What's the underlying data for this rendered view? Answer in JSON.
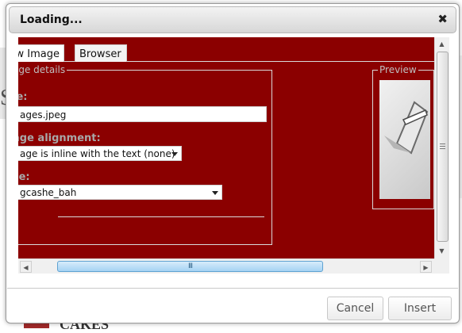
{
  "dialog": {
    "title": "Loading...",
    "close_glyph": "✖"
  },
  "tabs": [
    {
      "label": "w Image"
    },
    {
      "label": "Browser"
    }
  ],
  "details": {
    "legend": "age details",
    "file_label": "le:",
    "file_value": "ages.jpeg",
    "alignment_label": "age alignment:",
    "alignment_value": "age is inline with the text (none)",
    "size_label": "ze:",
    "size_value": "gcashe_bah"
  },
  "preview": {
    "legend": "Preview"
  },
  "scrollbar": {
    "h_thumb_grip": "III",
    "left_arrow": "◀",
    "right_arrow": "▶",
    "up_arrow": "▲",
    "down_arrow": "▼"
  },
  "buttons": {
    "cancel": "Cancel",
    "insert": "Insert"
  },
  "background": {
    "bottom_text": "CAKES",
    "side_letter": "S"
  },
  "colors": {
    "content_bg": "#8b0000",
    "label_color": "#a8a8a8"
  }
}
